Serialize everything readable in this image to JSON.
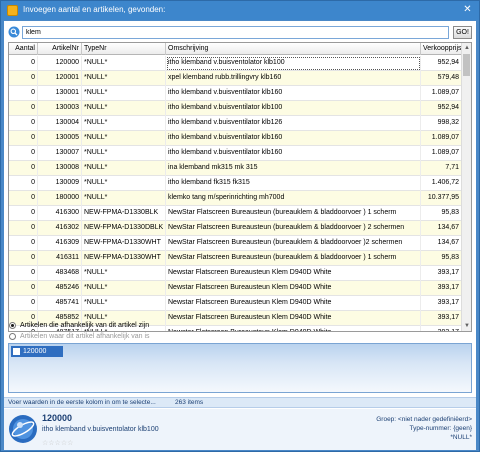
{
  "window": {
    "title": "Invoegen aantal en artikelen, gevonden:",
    "close_glyph": "✕"
  },
  "search": {
    "value": "klem",
    "go_label": "GO!"
  },
  "grid": {
    "columns": [
      "Aantal",
      "ArtikelNr",
      "TypeNr",
      "Omschrijving",
      "Verkoopprijs"
    ],
    "rows": [
      {
        "aantal": "0",
        "artnr": "120000",
        "type": "*NULL*",
        "omschr": "itho klemband v.buisventolator klb100",
        "prijs": "952,94"
      },
      {
        "aantal": "0",
        "artnr": "120001",
        "type": "*NULL*",
        "omschr": "xpel klemband rubb.trillingvry klb160",
        "prijs": "579,48"
      },
      {
        "aantal": "0",
        "artnr": "130001",
        "type": "*NULL*",
        "omschr": "itho klemband v.buisventilator klb160",
        "prijs": "1.089,07"
      },
      {
        "aantal": "0",
        "artnr": "130003",
        "type": "*NULL*",
        "omschr": "itho klemband v.buisventilator klb100",
        "prijs": "952,94"
      },
      {
        "aantal": "0",
        "artnr": "130004",
        "type": "*NULL*",
        "omschr": "itho klemband v.buisventilator klb126",
        "prijs": "998,32"
      },
      {
        "aantal": "0",
        "artnr": "130005",
        "type": "*NULL*",
        "omschr": "itho klemband v.buisventilator klb160",
        "prijs": "1.089,07"
      },
      {
        "aantal": "0",
        "artnr": "130007",
        "type": "*NULL*",
        "omschr": "itho klemband v.buisventilator klb160",
        "prijs": "1.089,07"
      },
      {
        "aantal": "0",
        "artnr": "130008",
        "type": "*NULL*",
        "omschr": "ina klemband    mk315              mk 315",
        "prijs": "7,71"
      },
      {
        "aantal": "0",
        "artnr": "130009",
        "type": "*NULL*",
        "omschr": "itho klemband           fk315 fk315",
        "prijs": "1.406,72"
      },
      {
        "aantal": "0",
        "artnr": "180000",
        "type": "*NULL*",
        "omschr": "klemko tang m/sperinrichting mh700d",
        "prijs": "10.377,95"
      },
      {
        "aantal": "0",
        "artnr": "416300",
        "type": "NEW-FPMA-D1330BLK",
        "omschr": "NewStar Flatscreen Bureausteun (bureauklem & bladdoorvoer ) 1 scherm",
        "prijs": "95,83"
      },
      {
        "aantal": "0",
        "artnr": "416302",
        "type": "NEW-FPMA-D1330DBLK",
        "omschr": "NewStar Flatscreen Bureausteun (bureauklem & bladdoorvoer ) 2 schermen",
        "prijs": "134,67"
      },
      {
        "aantal": "0",
        "artnr": "416309",
        "type": "NEW-FPMA-D1330WHT",
        "omschr": "NewStar Flatscreen Bureausteun (bureauklem & bladdoorvoer )2 schermen",
        "prijs": "134,67"
      },
      {
        "aantal": "0",
        "artnr": "416311",
        "type": "NEW-FPMA-D1330WHT",
        "omschr": "NewStar Flatscreen Bureausteun (bureauklem & bladdoorvoer ) 1 scherm",
        "prijs": "95,83"
      },
      {
        "aantal": "0",
        "artnr": "483468",
        "type": "*NULL*",
        "omschr": "Newstar Flatscreen Bureausteun Klem D940D White",
        "prijs": "393,17"
      },
      {
        "aantal": "0",
        "artnr": "485246",
        "type": "*NULL*",
        "omschr": "Newstar Flatscreen Bureausteun Klem D940D White",
        "prijs": "393,17"
      },
      {
        "aantal": "0",
        "artnr": "485741",
        "type": "*NULL*",
        "omschr": "Newstar Flatscreen Bureausteun Klem D940D White",
        "prijs": "393,17"
      },
      {
        "aantal": "0",
        "artnr": "485852",
        "type": "*NULL*",
        "omschr": "Newstar Flatscreen Bureausteun Klem D940D White",
        "prijs": "393,17"
      },
      {
        "aantal": "0",
        "artnr": "487517",
        "type": "*NULL*",
        "omschr": "Newstar Flatscreen Bureausteun Klem D940D White",
        "prijs": "393,17"
      }
    ]
  },
  "options": {
    "radio_1": "Artikelen die afhankelijk van dit artikel zijn",
    "radio_2": "Artikelen waar dit artikel afhankelijk van is"
  },
  "related": {
    "item": "120000"
  },
  "status": {
    "hint": "Voer waarden in de eerste kolom in om te selecte...",
    "count": "263 items"
  },
  "info": {
    "artnr": "120000",
    "description": "itho klemband v.buisventolator klb100",
    "groep": "Groep: <niet nader gedefiniëerd>",
    "typenummer": "Type-nummer: {geen}",
    "null_value": "*NULL*",
    "stars": "☆☆☆☆☆"
  },
  "colors": {
    "row_alt": "#fdfce3",
    "accent": "#2f6ec0",
    "title_bar": "#3d86cc"
  }
}
